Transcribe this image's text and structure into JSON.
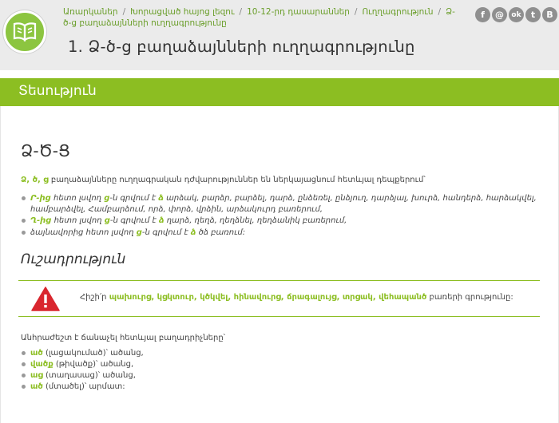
{
  "colors": {
    "accent": "#8cbe22",
    "header_bg": "#ebebeb",
    "warning": "#d9262e"
  },
  "header": {
    "breadcrumb": [
      "Առարկաներ",
      "Խորացված հայոց լեզու",
      "10-12-րդ դասարաններ",
      "Ուղղագրություն",
      "Ձ-ծ-ց բաղաձայնների ուղղագրությունը"
    ],
    "title": "1. Ձ-ծ-ց բաղաձայնների ուղղագրությունը",
    "social_icons": [
      {
        "icon": "facebook-icon",
        "glyph": "f"
      },
      {
        "icon": "email-icon",
        "glyph": "@"
      },
      {
        "icon": "odnoklassniki-icon",
        "glyph": "ok"
      },
      {
        "icon": "twitter-icon",
        "glyph": "t"
      },
      {
        "icon": "vk-icon",
        "glyph": "B"
      }
    ]
  },
  "theory_bar": {
    "label": "Տեսություն"
  },
  "content": {
    "section_title": "Ձ-Ծ-Ց",
    "intro": {
      "letters": "Ձ, ծ, ց",
      "text": " բաղաձայնները ուղղագրական դժվարություններ են ներկայացնում հետևյալ դեպքերում՝"
    },
    "rules": [
      {
        "pre": "Ր-ից",
        "t1": " հետո լսվող ",
        "hear": "ց",
        "t2": "-ն գրվում է ",
        "write": "ձ",
        "t3": " արձակ, բարձր, բարձել, դարձ, ընձեռել, ընձյուղ, դարձյալ, խուրձ, հանդերձ, հարձակվել, համբարձվել, Համբարձում, որձ, փորձ, վրձին, արձակուրդ բառերում,"
      },
      {
        "pre": "Ղ-ից",
        "t1": " հետո լսվող ",
        "hear": "ց",
        "t2": "-ն գրվում է ",
        "write": "ձ",
        "t3": " ղարձ, ղեղձ, ղեղձնել, ղեղձանիկ բառերում,"
      },
      {
        "pre": "",
        "t1": " ձայնավորից հետո լսվող ",
        "hear": "ց",
        "t2": "-ն գրվում է ",
        "write": "ձ",
        "t3": " ծձ բառում:"
      }
    ],
    "attention_title": "Ուշադրություն",
    "notice": {
      "prefix": "Հիշի՛ր ",
      "words": "պախուրց, կցկտուր, կծկվել, հինավուրց, ճրագալույց, տրցակ, վեհապանծ",
      "suffix": " բառերի գրությունը:"
    },
    "list_intro": "Անհրաժեշտ է ճանաչել հետևյալ բաղադրիչները՝",
    "morphemes": [
      {
        "word": "ած",
        "meaning": " (լացակումած)՝ ածանց,"
      },
      {
        "word": "վածք",
        "meaning": " (թիվածք)՝ ածանց,"
      },
      {
        "word": "աց",
        "meaning": " (տաղասաց)՝ ածանց,"
      },
      {
        "word": "ած",
        "meaning": " (մտածել)՝ արմատ:"
      }
    ]
  }
}
